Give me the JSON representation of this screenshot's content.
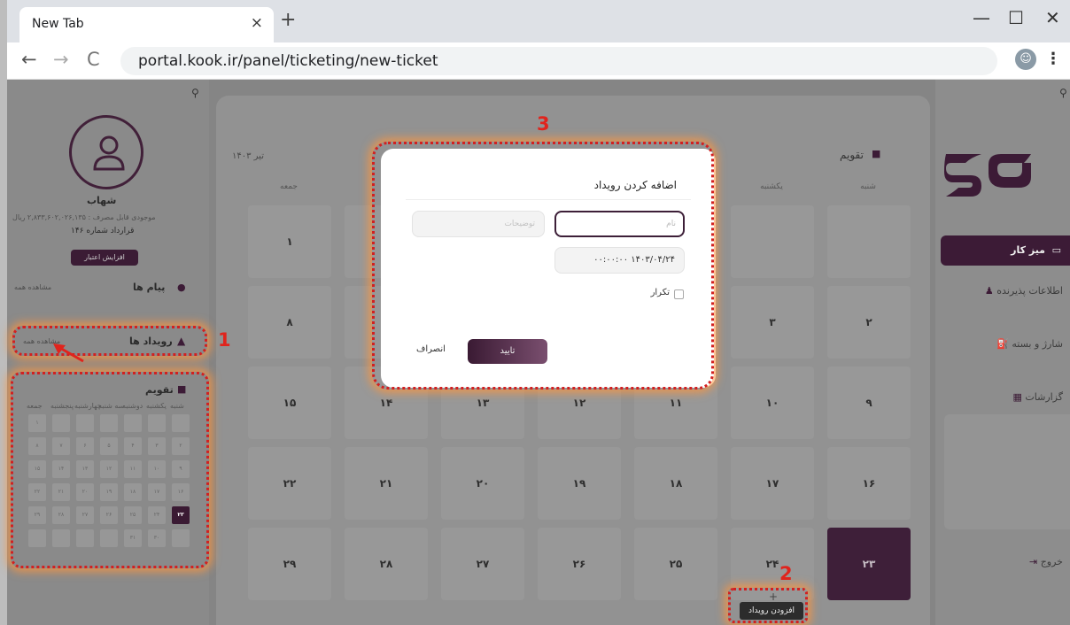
{
  "browser": {
    "tab_title": "New Tab",
    "tab_close": "×",
    "new_tab": "+",
    "minimize": "—",
    "maximize": "☐",
    "close": "✕",
    "back": "←",
    "forward": "→",
    "reload": "C",
    "url": "portal.kook.ir/panel/ticketing/new-ticket",
    "menu": "⋮"
  },
  "left_sidebar": {
    "user_name": "شهاب",
    "balance": "موجودی قابل مصرف : ۲,۸۳۳,۶۰۲,۰۲۶,۱۳۵ ریال",
    "contract": "قرارداد شماره ۱۴۶",
    "increase_credit": "افزایش اعتبار",
    "messages_title": "پیام ها",
    "messages_see_all": "مشاهده همه",
    "events_title": "رویداد ها",
    "events_see_all": "مشاهده همه",
    "calendar_title": "تقویم",
    "weekdays": [
      "شنبه",
      "یکشنبه",
      "دوشنبه",
      "سه شنبه",
      "چهارشنبه",
      "پنجشنبه",
      "جمعه"
    ],
    "rows": [
      [
        "",
        "",
        "",
        "",
        "",
        "",
        "۱"
      ],
      [
        "۲",
        "۳",
        "۴",
        "۵",
        "۶",
        "۷",
        "۸"
      ],
      [
        "۹",
        "۱۰",
        "۱۱",
        "۱۲",
        "۱۳",
        "۱۴",
        "۱۵"
      ],
      [
        "۱۶",
        "۱۷",
        "۱۸",
        "۱۹",
        "۲۰",
        "۲۱",
        "۲۲"
      ],
      [
        "۲۳",
        "۲۴",
        "۲۵",
        "۲۶",
        "۲۷",
        "۲۸",
        "۲۹"
      ],
      [
        "",
        "۳۰",
        "۳۱",
        "",
        "",
        "",
        ""
      ]
    ],
    "today": "۲۳"
  },
  "main_calendar": {
    "title": "تقویم",
    "month": "تیر ۱۴۰۳",
    "weekdays": [
      "شنبه",
      "یکشنبه",
      "",
      "",
      "",
      "",
      "جمعه"
    ],
    "rows": [
      [
        "",
        "",
        "",
        "",
        "",
        "",
        "۱"
      ],
      [
        "۲",
        "۳",
        "",
        "",
        "",
        "",
        "۸"
      ],
      [
        "۹",
        "۱۰",
        "۱۱",
        "۱۲",
        "۱۳",
        "۱۴",
        "۱۵"
      ],
      [
        "۱۶",
        "۱۷",
        "۱۸",
        "۱۹",
        "۲۰",
        "۲۱",
        "۲۲"
      ],
      [
        "۲۳",
        "۲۴",
        "۲۵",
        "۲۶",
        "۲۷",
        "۲۸",
        "۲۹"
      ]
    ],
    "selected": "۲۳",
    "add_event_plus": "+",
    "add_event_tooltip": "افزودن رویداد"
  },
  "right_sidebar": {
    "dashboard": "میز کار",
    "receiver_info": "اطلاعات پذیرنده",
    "charge_package": "شارژ و بسته",
    "reports": "گزارشات",
    "logout": "خروج"
  },
  "modal": {
    "title": "اضافه کردن رویداد",
    "name_placeholder": "نام",
    "desc_placeholder": "توضیحات",
    "datetime": "۱۴۰۳/۰۴/۲۴ ۰۰:۰۰:۰۰",
    "repeat_label": "تکرار",
    "confirm": "تایید",
    "cancel": "انصراف"
  },
  "annotations": [
    "1",
    "2",
    "3"
  ],
  "colors": {
    "brand": "#3c1b36",
    "highlight": "#d22020"
  }
}
